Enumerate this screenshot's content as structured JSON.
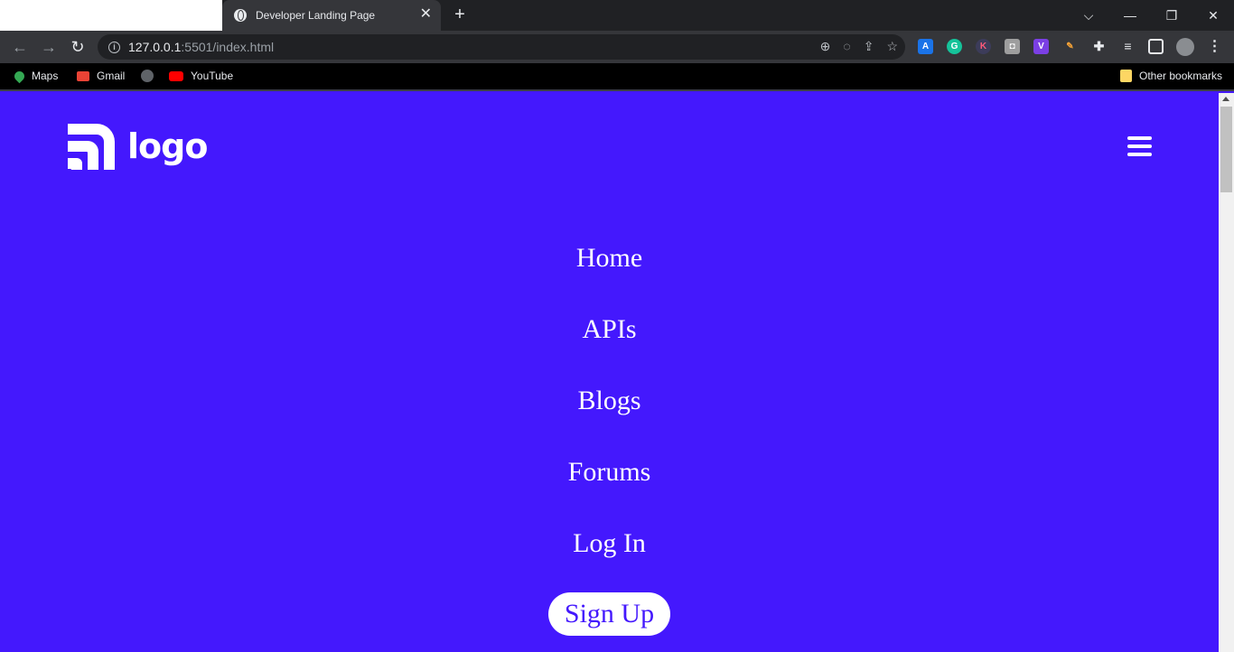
{
  "browser": {
    "tab_title": "Developer Landing Page",
    "url_host": "127.0.0.1",
    "url_rest": ":5501/index.html",
    "bookmarks": [
      "Maps",
      "Gmail",
      "YouTube"
    ],
    "other_bookmarks": "Other bookmarks"
  },
  "page": {
    "logo_text": "logo",
    "nav_items": [
      "Home",
      "APIs",
      "Blogs",
      "Forums",
      "Log In"
    ],
    "signup_label": "Sign Up",
    "colors": {
      "background": "#4418fd",
      "text": "#ffffff",
      "button_bg": "#ffffff"
    }
  }
}
